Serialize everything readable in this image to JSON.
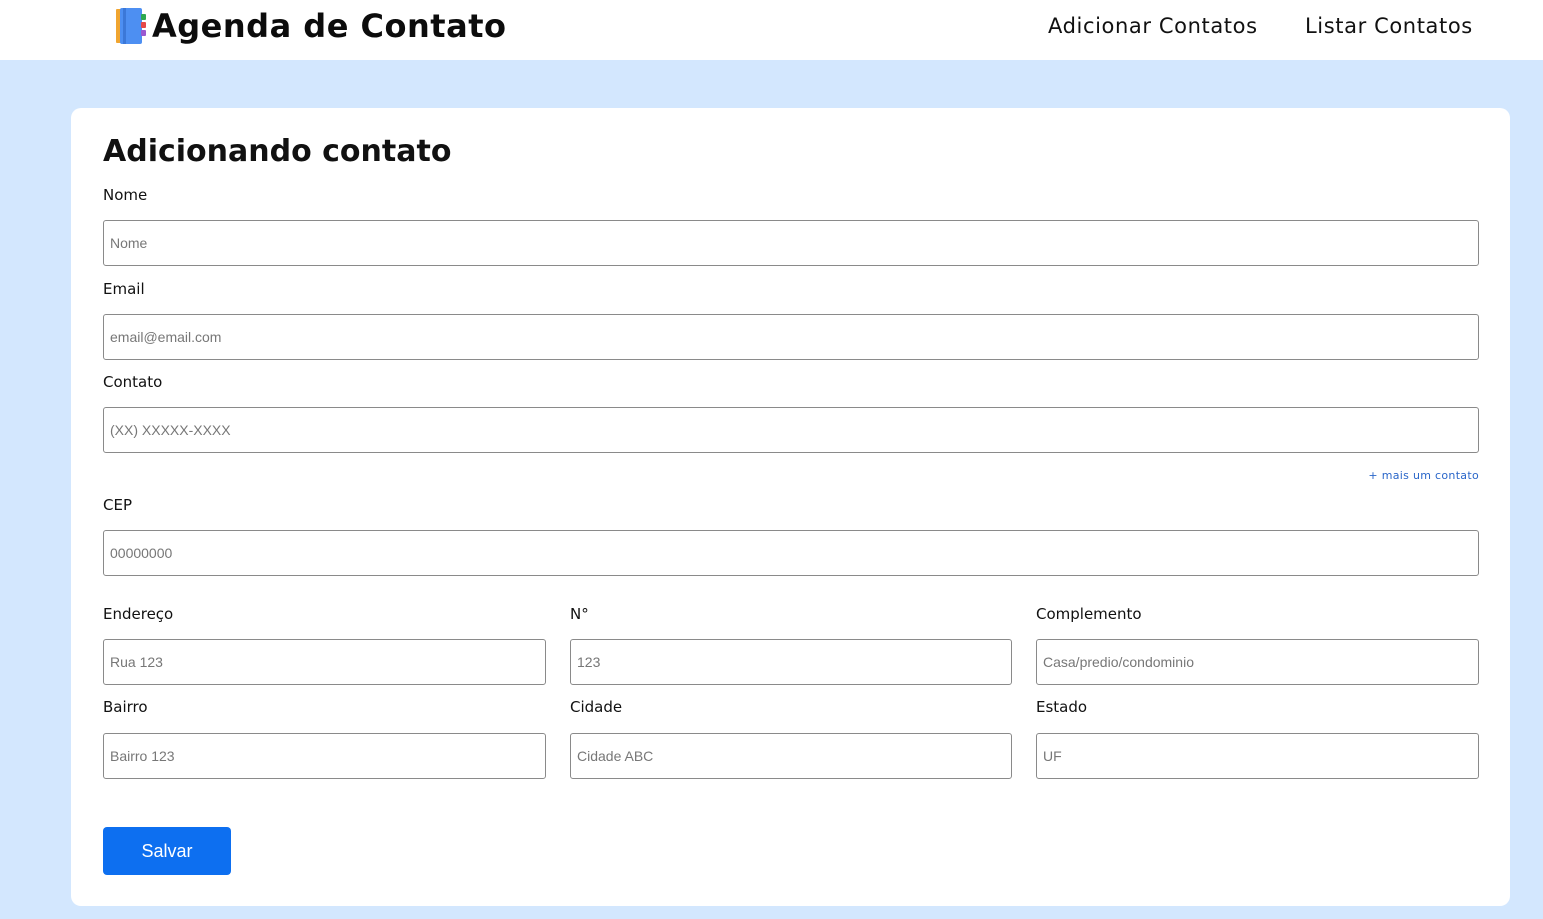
{
  "header": {
    "title": "Agenda de Contato",
    "icon": "address-book-icon",
    "nav": {
      "add_contacts": "Adicionar Contatos",
      "list_contacts": "Listar Contatos"
    }
  },
  "form": {
    "title": "Adicionando contato",
    "name": {
      "label": "Nome",
      "placeholder": "Nome",
      "value": ""
    },
    "email": {
      "label": "Email",
      "placeholder": "email@email.com",
      "value": ""
    },
    "contact": {
      "label": "Contato",
      "placeholder": "(XX) XXXXX-XXXX",
      "value": ""
    },
    "add_contact_link": "+ mais um contato",
    "cep": {
      "label": "CEP",
      "placeholder": "00000000",
      "value": ""
    },
    "address": {
      "label": "Endereço",
      "placeholder": "Rua 123",
      "value": ""
    },
    "number": {
      "label": "N°",
      "placeholder": "123",
      "value": ""
    },
    "complement": {
      "label": "Complemento",
      "placeholder": "Casa/predio/condominio",
      "value": ""
    },
    "district": {
      "label": "Bairro",
      "placeholder": "Bairro 123",
      "value": ""
    },
    "city": {
      "label": "Cidade",
      "placeholder": "Cidade ABC",
      "value": ""
    },
    "state": {
      "label": "Estado",
      "placeholder": "UF",
      "value": ""
    },
    "save_label": "Salvar"
  },
  "colors": {
    "page_background": "#d3e7fe",
    "primary_button": "#0d6ff0",
    "link": "#2a66c9"
  }
}
